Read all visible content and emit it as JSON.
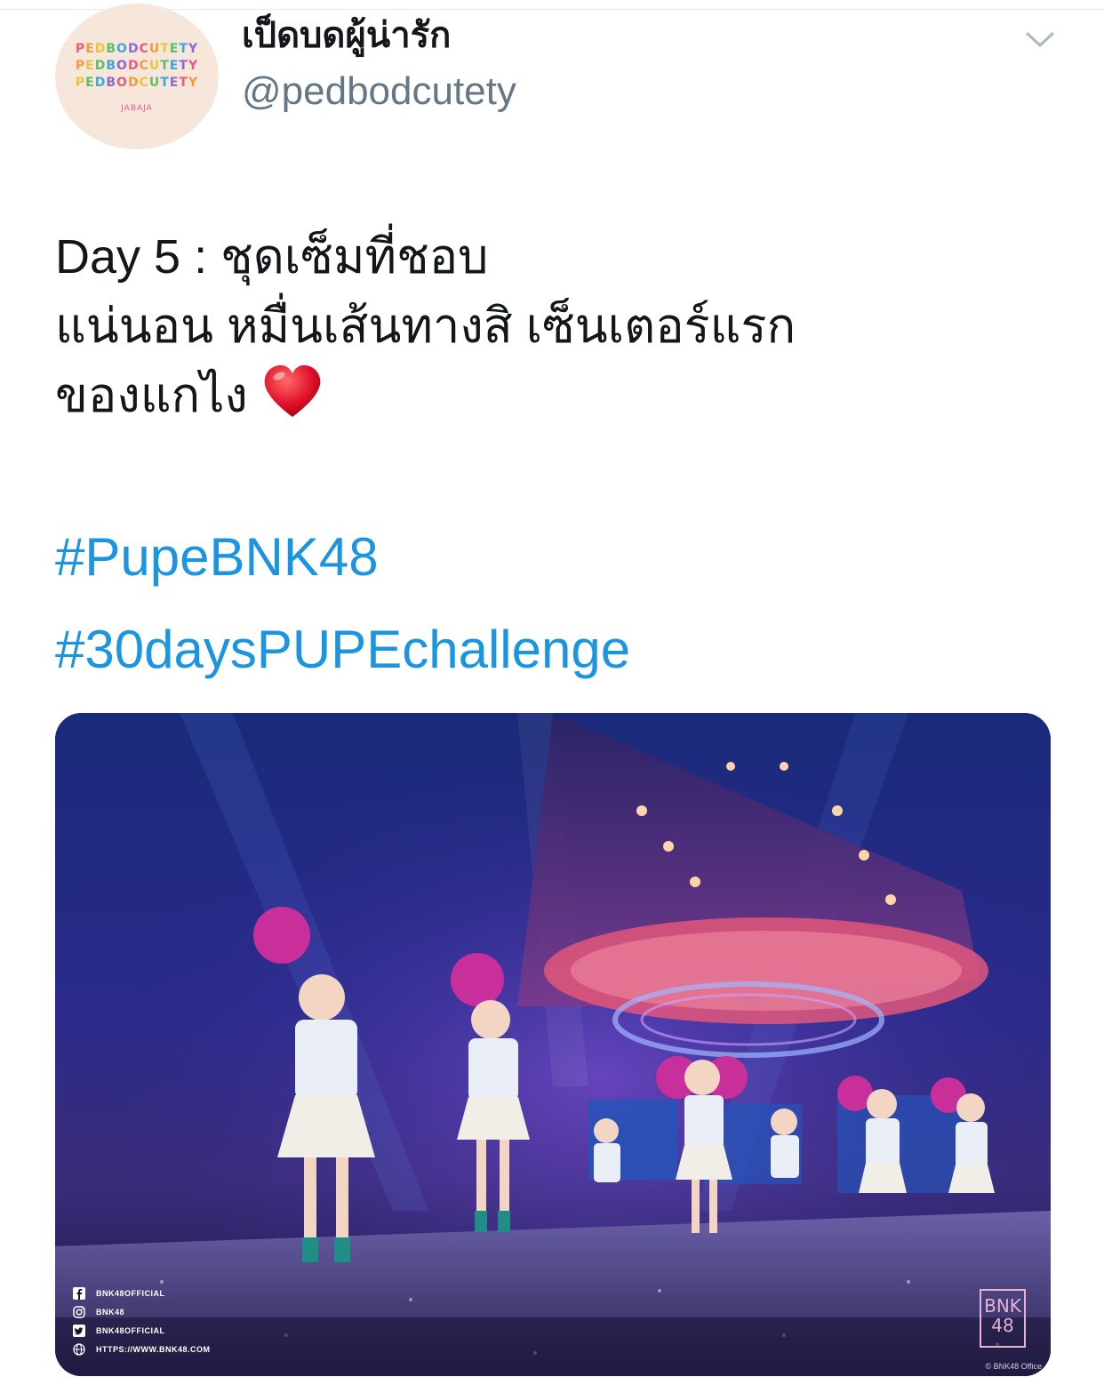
{
  "tweet": {
    "display_name": "เป็ดบดผู้น่ารัก",
    "handle": "@pedbodcutety",
    "avatar": {
      "lines": [
        "PEDBODCUTETY",
        "PEDBODCUTETY",
        "PEDBODCUTETY"
      ],
      "sub_text": "JABAJA",
      "colors": [
        "#e35c83",
        "#f29a3d",
        "#e8c53c",
        "#5bbf6a",
        "#3fa6d8",
        "#8a6ad0"
      ]
    },
    "menu_icon": "chevron-down-icon",
    "text_lines": [
      "Day 5 : ชุดเซ็มที่ชอบ",
      "แน่นอน หมื่นเส้นทางสิ เซ็นเตอร์แรก",
      "ของแกไง"
    ],
    "emoji": "heart-icon",
    "hashtags": [
      "#PupeBNK48",
      "#30daysPUPEchallenge"
    ],
    "link_color": "#1b95e0",
    "media": {
      "social": [
        {
          "icon": "facebook-icon",
          "text": "BNK48OFFICIAL"
        },
        {
          "icon": "instagram-icon",
          "text": "BNK48"
        },
        {
          "icon": "twitter-icon",
          "text": "BNK48OFFICIAL"
        },
        {
          "icon": "globe-icon",
          "text": "HTTPS://WWW.BNK48.COM"
        }
      ],
      "logo_lines": [
        "BNK",
        "48"
      ],
      "credit": "© BNK48 Office"
    }
  }
}
